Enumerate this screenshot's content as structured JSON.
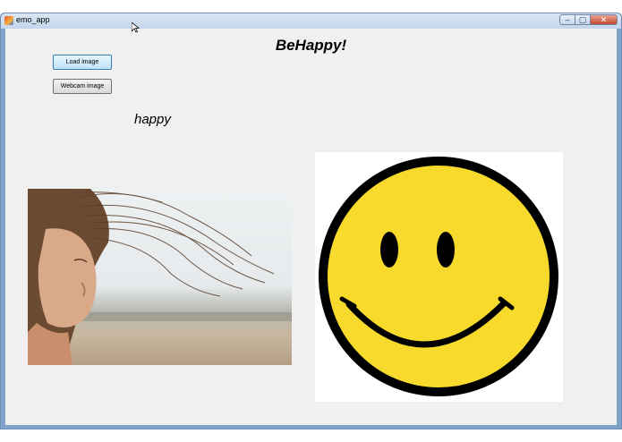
{
  "window": {
    "title": "emo_app",
    "controls": {
      "minimize": "–",
      "maximize": "▢",
      "close": "✕"
    }
  },
  "app": {
    "heading": "BeHappy!",
    "load_button": "Load image",
    "webcam_button": "Webcam image",
    "emotion": "happy"
  },
  "images": {
    "photo_icon": "woman-face-photo",
    "emoji_icon": "smiley-face-icon"
  },
  "colors": {
    "smiley_fill": "#f8da2c",
    "smiley_outline": "#000000"
  }
}
